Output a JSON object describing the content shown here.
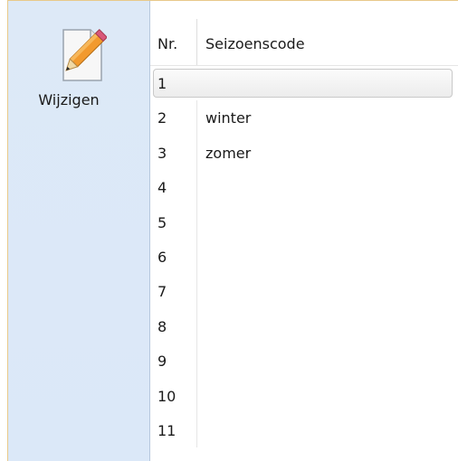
{
  "toolbar": {
    "edit_label": "Wijzigen",
    "edit_icon": "pencil-document-icon"
  },
  "table": {
    "columns": [
      "Nr.",
      "Seizoenscode"
    ],
    "rows": [
      {
        "nr": "1",
        "code": ""
      },
      {
        "nr": "2",
        "code": "winter"
      },
      {
        "nr": "3",
        "code": "zomer"
      },
      {
        "nr": "4",
        "code": ""
      },
      {
        "nr": "5",
        "code": ""
      },
      {
        "nr": "6",
        "code": ""
      },
      {
        "nr": "7",
        "code": ""
      },
      {
        "nr": "8",
        "code": ""
      },
      {
        "nr": "9",
        "code": ""
      },
      {
        "nr": "10",
        "code": ""
      },
      {
        "nr": "11",
        "code": ""
      }
    ],
    "selected_row": "1"
  },
  "colors": {
    "sidebar_bg": "#dde9f7",
    "window_border": "#e8c98a",
    "pencil_orange": "#f29a2e"
  }
}
